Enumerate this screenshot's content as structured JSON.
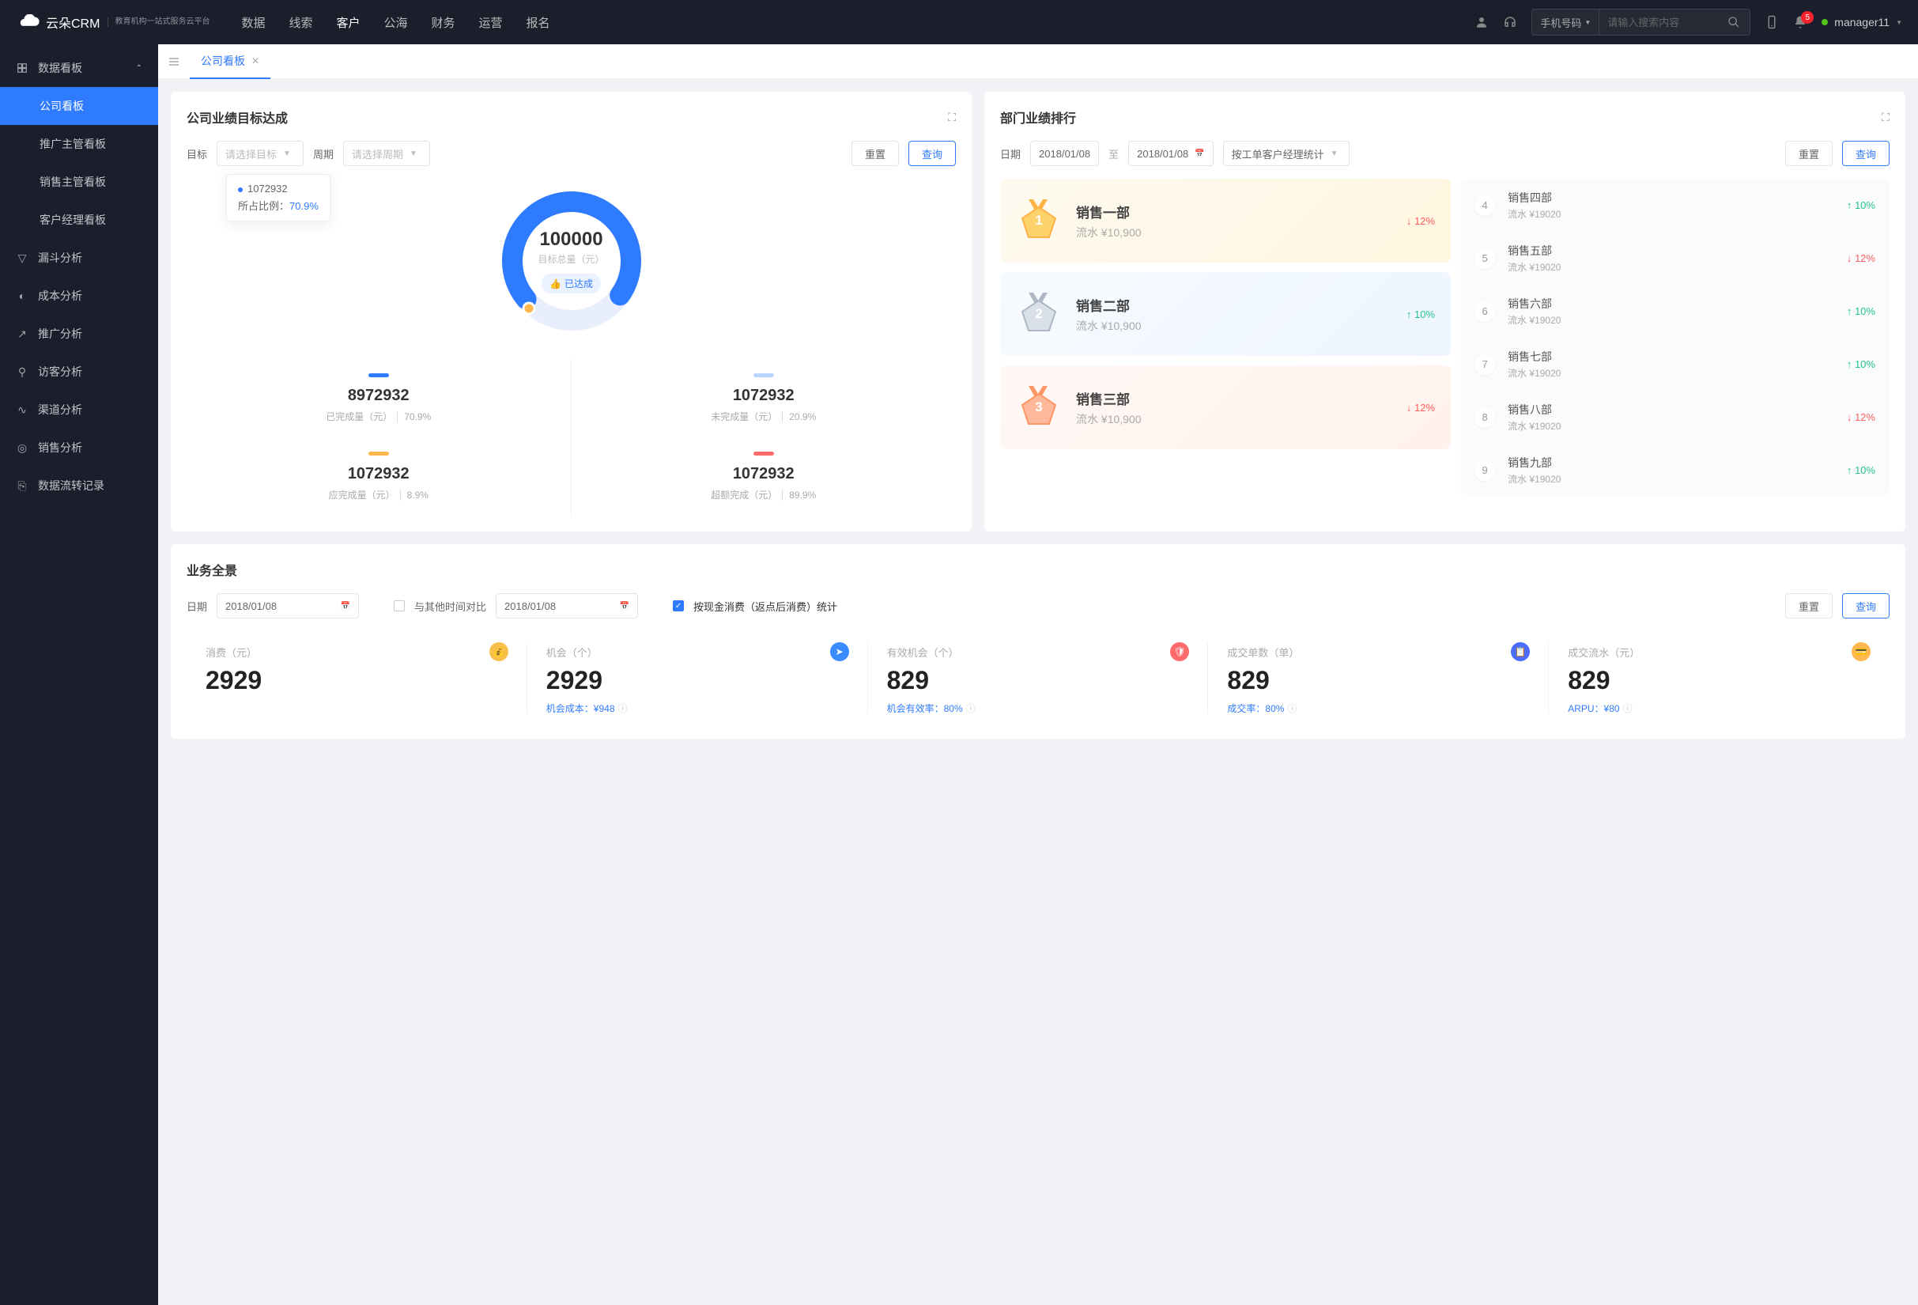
{
  "header": {
    "logo_text": "云朵CRM",
    "logo_sub": "教育机构一站式服务云平台",
    "nav": [
      "数据",
      "线索",
      "客户",
      "公海",
      "财务",
      "运营",
      "报名"
    ],
    "nav_active_index": 2,
    "search_type": "手机号码",
    "search_placeholder": "请输入搜索内容",
    "notif_count": "5",
    "username": "manager11"
  },
  "sidebar": {
    "group": "数据看板",
    "subs": [
      "公司看板",
      "推广主管看板",
      "销售主管看板",
      "客户经理看板"
    ],
    "sub_active_index": 0,
    "items": [
      "漏斗分析",
      "成本分析",
      "推广分析",
      "访客分析",
      "渠道分析",
      "销售分析",
      "数据流转记录"
    ]
  },
  "tabs": {
    "active": "公司看板"
  },
  "target_card": {
    "title": "公司业绩目标达成",
    "target_label": "目标",
    "target_ph": "请选择目标",
    "period_label": "周期",
    "period_ph": "请选择周期",
    "reset": "重置",
    "query": "查询",
    "tooltip_value": "1072932",
    "tooltip_label": "所占比例：",
    "tooltip_pct": "70.9%",
    "center_value": "100000",
    "center_label": "目标总量（元）",
    "badge": "已达成",
    "stats": [
      {
        "color": "#2f7bff",
        "num": "8972932",
        "label": "已完成量（元）",
        "pct": "70.9%"
      },
      {
        "color": "#b7d5ff",
        "num": "1072932",
        "label": "未完成量（元）",
        "pct": "20.9%"
      },
      {
        "color": "#ffb84d",
        "num": "1072932",
        "label": "应完成量（元）",
        "pct": "8.9%"
      },
      {
        "color": "#ff6b6b",
        "num": "1072932",
        "label": "超额完成（元）",
        "pct": "89.9%"
      }
    ]
  },
  "rank_card": {
    "title": "部门业绩排行",
    "date_label": "日期",
    "date_from": "2018/01/08",
    "date_to": "2018/01/08",
    "date_sep": "至",
    "mode": "按工单客户经理统计",
    "reset": "重置",
    "query": "查询",
    "rev_prefix": "流水 ",
    "top3": [
      {
        "name": "销售一部",
        "rev": "¥10,900",
        "change": "12%",
        "dir": "down"
      },
      {
        "name": "销售二部",
        "rev": "¥10,900",
        "change": "10%",
        "dir": "up"
      },
      {
        "name": "销售三部",
        "rev": "¥10,900",
        "change": "12%",
        "dir": "down"
      }
    ],
    "rest": [
      {
        "idx": "4",
        "name": "销售四部",
        "rev": "¥19020",
        "change": "10%",
        "dir": "up"
      },
      {
        "idx": "5",
        "name": "销售五部",
        "rev": "¥19020",
        "change": "12%",
        "dir": "down"
      },
      {
        "idx": "6",
        "name": "销售六部",
        "rev": "¥19020",
        "change": "10%",
        "dir": "up"
      },
      {
        "idx": "7",
        "name": "销售七部",
        "rev": "¥19020",
        "change": "10%",
        "dir": "up"
      },
      {
        "idx": "8",
        "name": "销售八部",
        "rev": "¥19020",
        "change": "12%",
        "dir": "down"
      },
      {
        "idx": "9",
        "name": "销售九部",
        "rev": "¥19020",
        "change": "10%",
        "dir": "up"
      }
    ]
  },
  "overview": {
    "title": "业务全景",
    "date_label": "日期",
    "date1": "2018/01/08",
    "compare_label": "与其他时间对比",
    "date2": "2018/01/08",
    "check_label": "按现金消费（返点后消费）统计",
    "reset": "重置",
    "query": "查询",
    "kpis": [
      {
        "label": "消费（元）",
        "value": "2929",
        "foot": "",
        "color": "#f7c04a"
      },
      {
        "label": "机会（个）",
        "value": "2929",
        "foot": "机会成本：¥948",
        "color": "#3a8bff"
      },
      {
        "label": "有效机会（个）",
        "value": "829",
        "foot": "机会有效率：80%",
        "color": "#ff6b6b"
      },
      {
        "label": "成交单数（单）",
        "value": "829",
        "foot": "成交率：80%",
        "color": "#4a6cff"
      },
      {
        "label": "成交流水（元）",
        "value": "829",
        "foot": "ARPU：¥80",
        "color": "#ffb84d"
      }
    ]
  },
  "chart_data": {
    "type": "pie",
    "title": "目标总量（元）",
    "total": 100000,
    "series": [
      {
        "name": "已完成量（元）",
        "value": 8972932,
        "pct": 70.9,
        "color": "#2f7bff"
      },
      {
        "name": "未完成量（元）",
        "value": 1072932,
        "pct": 20.9,
        "color": "#b7d5ff"
      },
      {
        "name": "应完成量（元）",
        "value": 1072932,
        "pct": 8.9,
        "color": "#ffb84d"
      },
      {
        "name": "超额完成（元）",
        "value": 1072932,
        "pct": 89.9,
        "color": "#ff6b6b"
      }
    ]
  }
}
